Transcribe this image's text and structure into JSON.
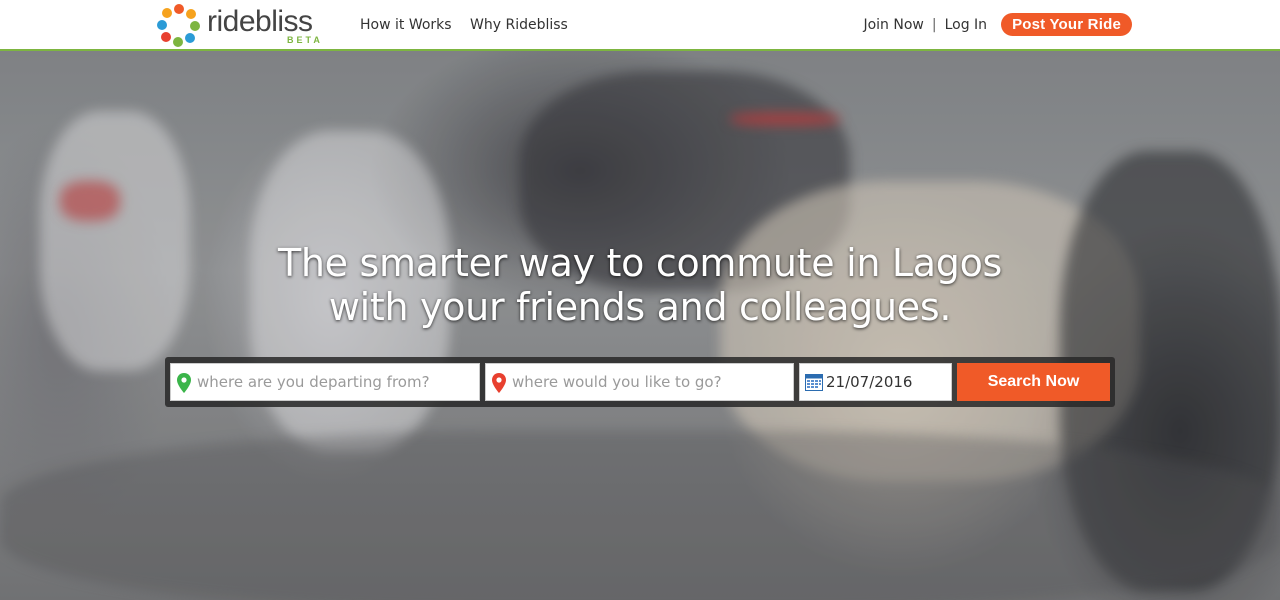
{
  "header": {
    "logo_text": "ridebliss",
    "logo_badge": "BETA",
    "nav": [
      {
        "label": "How it Works"
      },
      {
        "label": "Why Ridebliss"
      }
    ],
    "join_label": "Join Now",
    "login_label": "Log In",
    "post_ride_label": "Post Your Ride"
  },
  "hero": {
    "headline_line1": "The smarter way to commute in Lagos",
    "headline_line2": "with your friends and colleagues."
  },
  "search": {
    "from_placeholder": "where are you departing from?",
    "to_placeholder": "where would you like to go?",
    "date_value": "21/07/2016",
    "button_label": "Search Now"
  },
  "colors": {
    "accent": "#f05a28",
    "brand_green": "#7db540"
  },
  "icons": {
    "from": "map-pin-green-icon",
    "to": "map-pin-red-icon",
    "date": "calendar-icon"
  }
}
